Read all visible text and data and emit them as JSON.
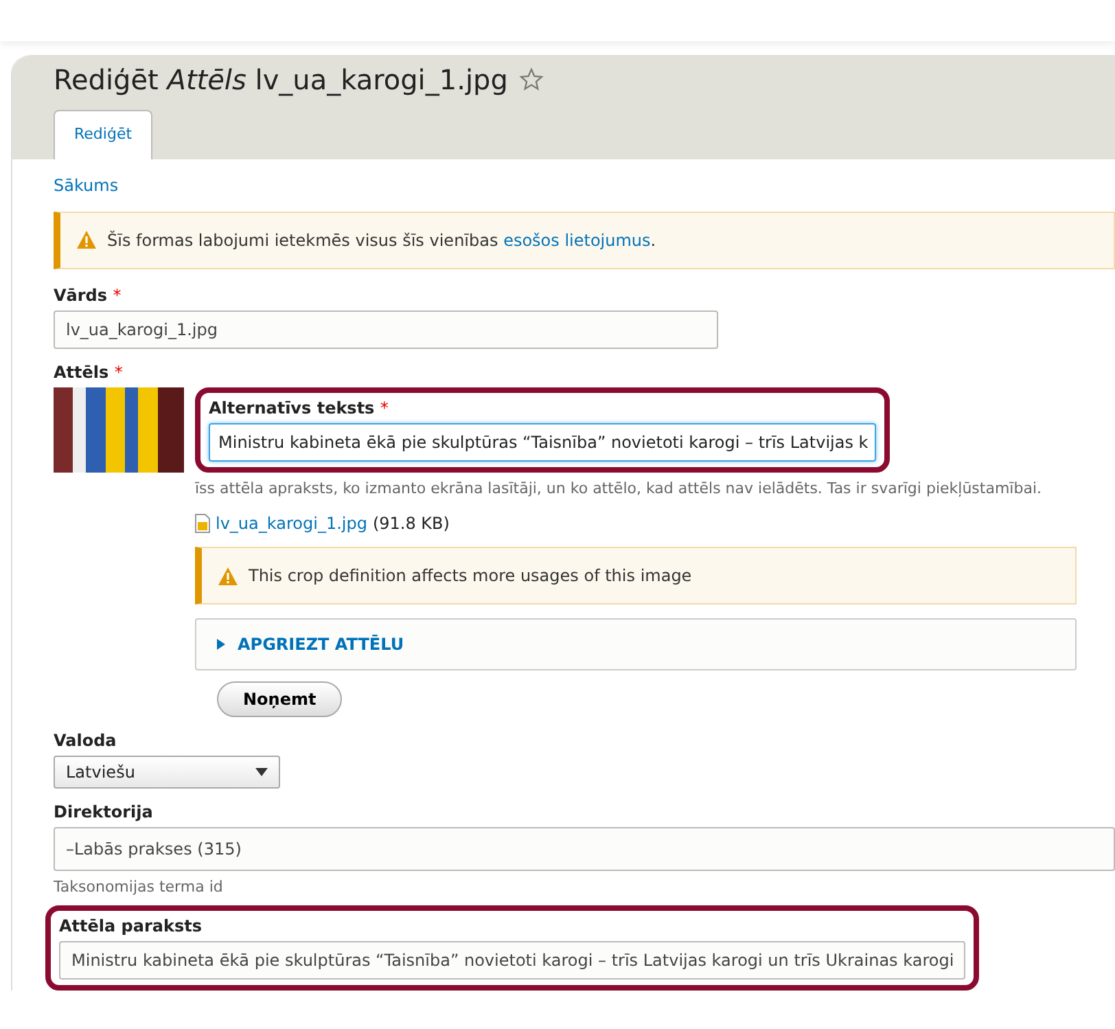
{
  "page_title": {
    "prefix": "Rediģēt",
    "entity_type": "Attēls",
    "name": "lv_ua_karogi_1.jpg",
    "favorite": false
  },
  "tabs": [
    {
      "label": "Rediģēt",
      "selected": true
    }
  ],
  "breadcrumb": [
    "Sākums"
  ],
  "required_mark": "*",
  "warning": {
    "text": "Šīs formas labojumi ietekmēs visus šīs vienības",
    "link": "esošos lietojumus",
    "suffix": "."
  },
  "name_field": {
    "label": "Vārds",
    "required": true,
    "value": "lv_ua_karogi_1.jpg"
  },
  "image_field": {
    "label": "Attēls",
    "required": true,
    "alt": {
      "label": "Alternatīvs teksts",
      "required": true,
      "value": "Ministru kabineta ēkā pie skulptūras “Taisnība” novietoti karogi – trīs Latvijas k",
      "description": "īss attēla apraksts, ko izmanto ekrāna lasītāji, un ko attēlo, kad attēls nav ielādēts. Tas ir svarīgi piekļūstamībai.",
      "highlighted": true
    },
    "file_link": "lv_ua_karogi_1.jpg",
    "file_size": "(91.8 KB)",
    "crop_warning": "This crop definition affects more usages of this image",
    "crop_details": {
      "label": "APGRIEZT ATTĒLU",
      "expanded": false
    },
    "remove_button": "Noņemt"
  },
  "language_field": {
    "label": "Valoda",
    "value": "Latviešu"
  },
  "directory_field": {
    "label": "Direktorija",
    "value": "–Labās prakses (315)",
    "description": "Taksonomijas terma id"
  },
  "caption_field": {
    "label": "Attēla paraksts",
    "value": "Ministru kabineta ēkā pie skulptūras “Taisnība” novietoti karogi – trīs Latvijas karogi un trīs Ukrainas karogi",
    "highlighted": true
  }
}
